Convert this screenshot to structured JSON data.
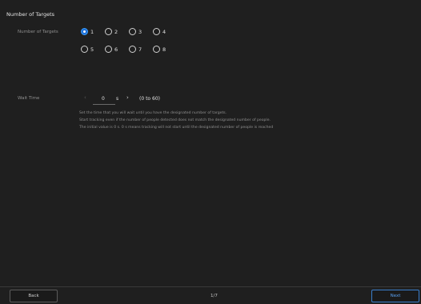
{
  "page": {
    "title": "Number of Targets"
  },
  "targets": {
    "label": "Number of Targets",
    "selected": "1",
    "options": [
      "1",
      "2",
      "3",
      "4",
      "5",
      "6",
      "7",
      "8"
    ]
  },
  "wait_time": {
    "label": "Wait Time",
    "value": "0",
    "unit": "s",
    "range": "(0 to 60)",
    "prev_icon": "chevron-left-icon",
    "next_icon": "chevron-right-icon",
    "help_lines": [
      "Set the time that you will wait until you have the designated number of targets.",
      "Start tracking even if the number of people detected does not match the designated number of people.",
      "The initial value is 0 s. 0 s means tracking will not start until the designated number of people is reached"
    ]
  },
  "footer": {
    "back_label": "Back",
    "page_indicator": "1/7",
    "next_label": "Next"
  },
  "colors": {
    "background": "#1f1f1f",
    "accent": "#1e6ed6",
    "next_button": "#3a7ecb"
  }
}
